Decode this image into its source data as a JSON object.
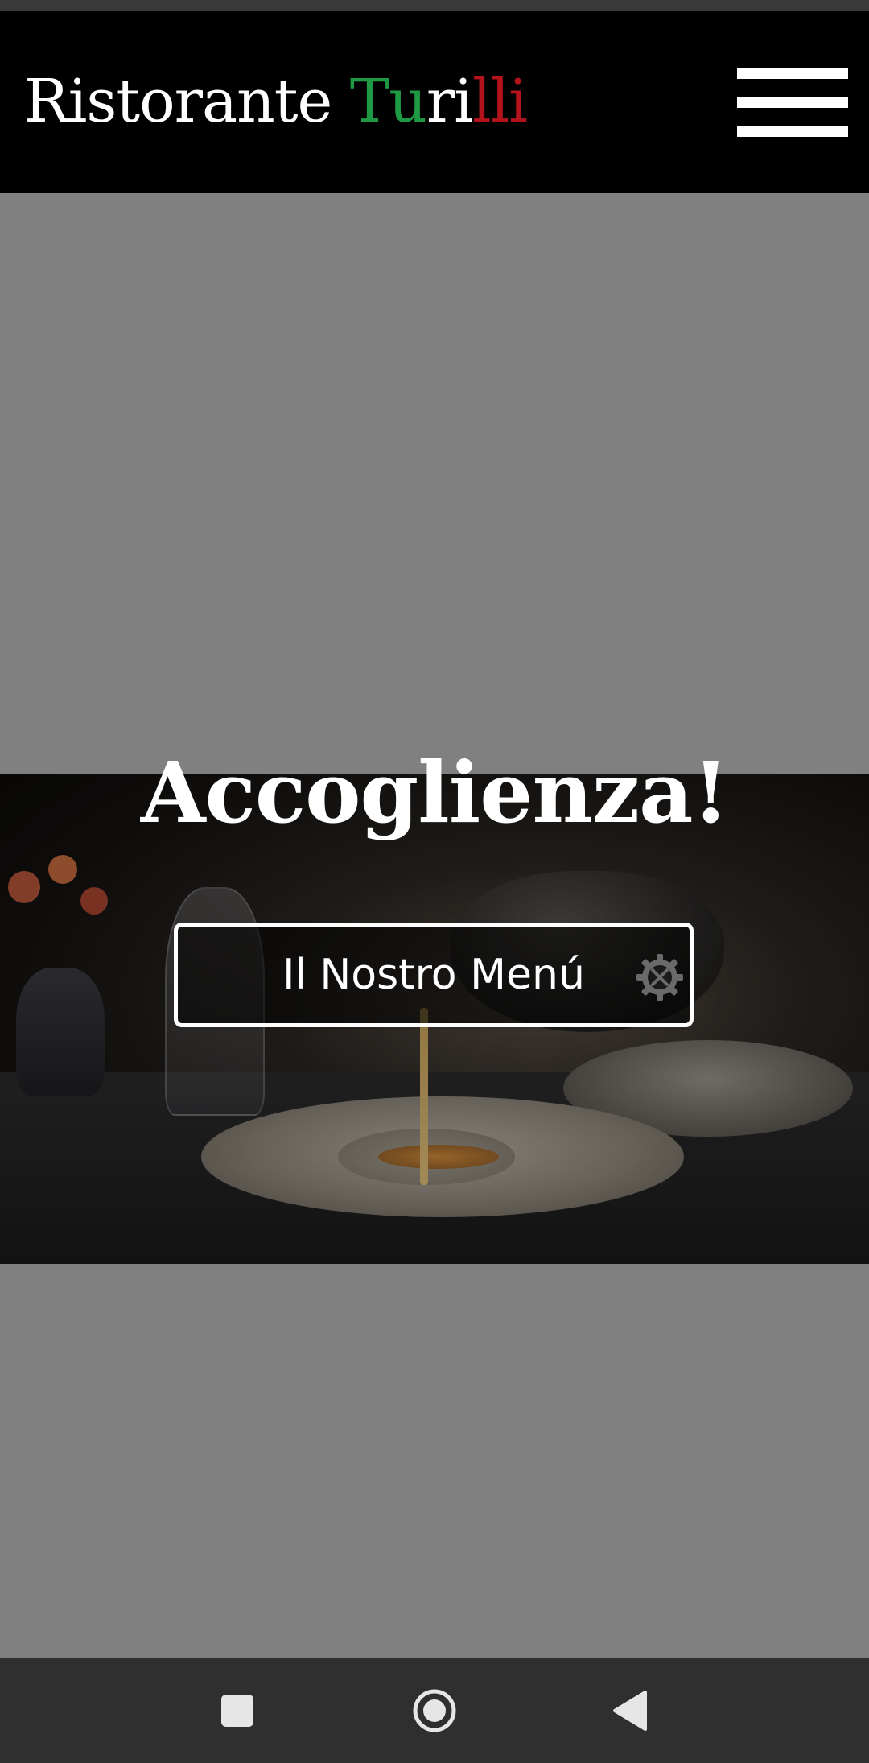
{
  "header": {
    "brand_part1": "Ristorante ",
    "brand_part2a": "Tu",
    "brand_part2b": "ri",
    "brand_part2c": "lli",
    "menu_icon": "hamburger-menu-icon"
  },
  "hero": {
    "title": "Accoglienza!",
    "button_label": "Il Nostro Menú",
    "button_icon": "tools-gear-icon"
  },
  "navigation_bar": {
    "recent_icon": "recent-apps-square-icon",
    "home_icon": "home-circle-icon",
    "back_icon": "back-triangle-icon"
  },
  "colors": {
    "header_background": "#000000",
    "page_background": "#808080",
    "brand_green": "#1e9a45",
    "brand_red": "#b3141c",
    "nav_bar": "#2f2f2f",
    "text": "#ffffff"
  }
}
